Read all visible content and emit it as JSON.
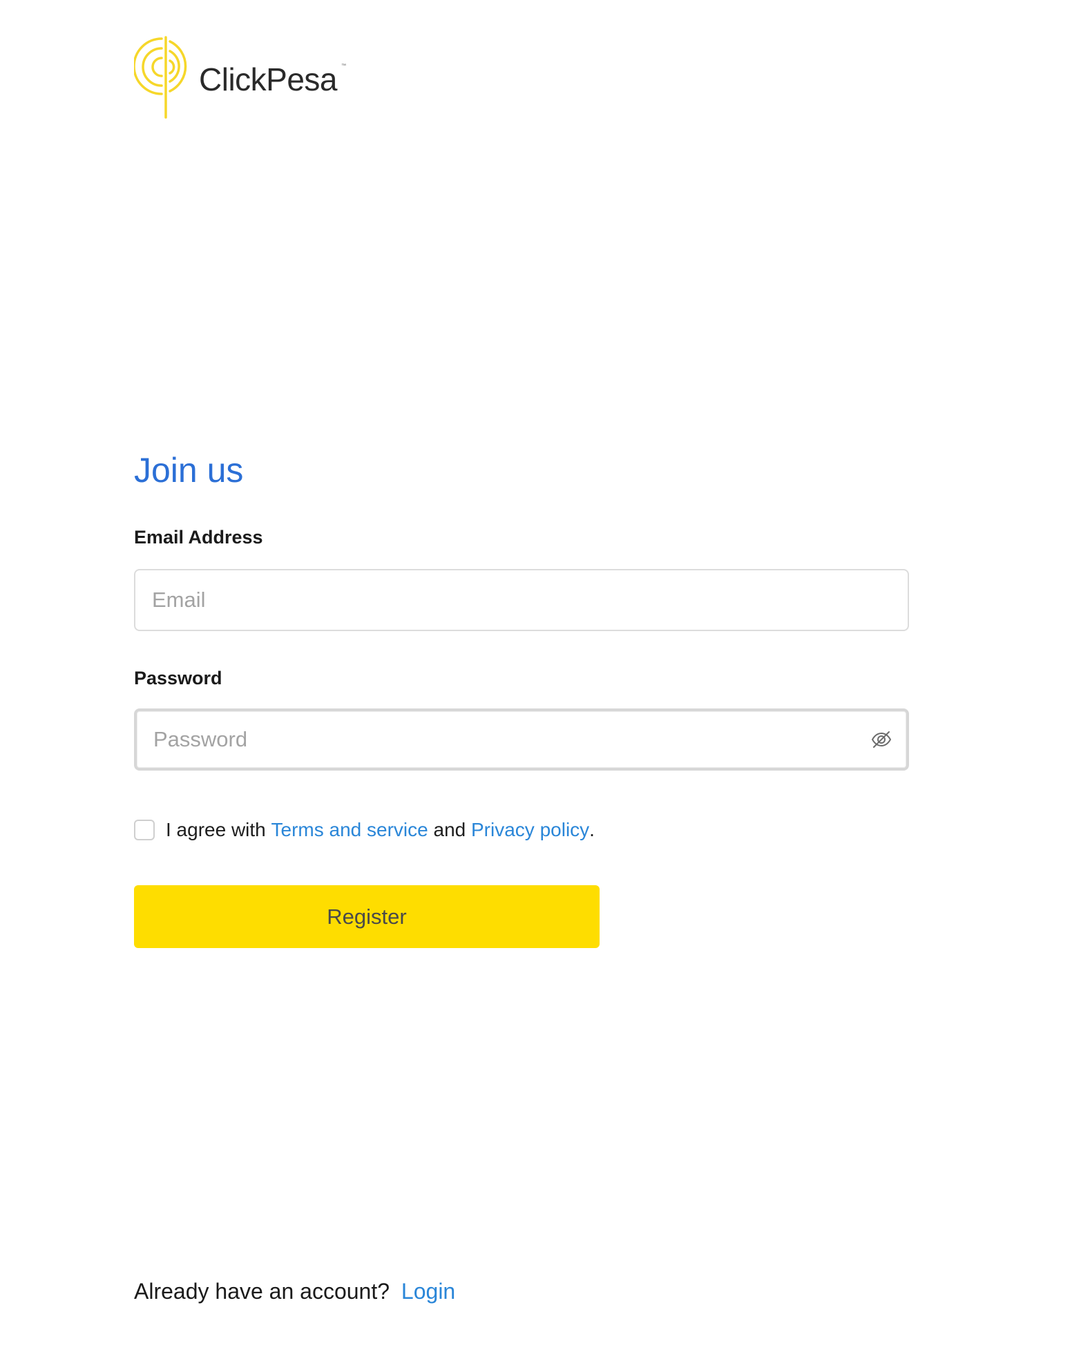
{
  "brand": {
    "name": "ClickPesa",
    "trademark": "™",
    "logo_icon": "clickpesa-logo-icon",
    "color": "#f6d72a"
  },
  "form": {
    "heading": "Join us",
    "email": {
      "label": "Email Address",
      "placeholder": "Email",
      "value": ""
    },
    "password": {
      "label": "Password",
      "placeholder": "Password",
      "value": "",
      "toggle_icon": "eye-off-icon"
    },
    "agreement": {
      "checked": false,
      "prefix": "I agree with ",
      "terms_link": "Terms and service",
      "middle": " and ",
      "privacy_link": "Privacy policy",
      "suffix": "."
    },
    "register_label": "Register"
  },
  "footer": {
    "prompt": "Already have an account?",
    "login_link": "Login"
  },
  "colors": {
    "heading": "#2b6fd6",
    "link": "#2a86d8",
    "button": "#fedd00"
  }
}
